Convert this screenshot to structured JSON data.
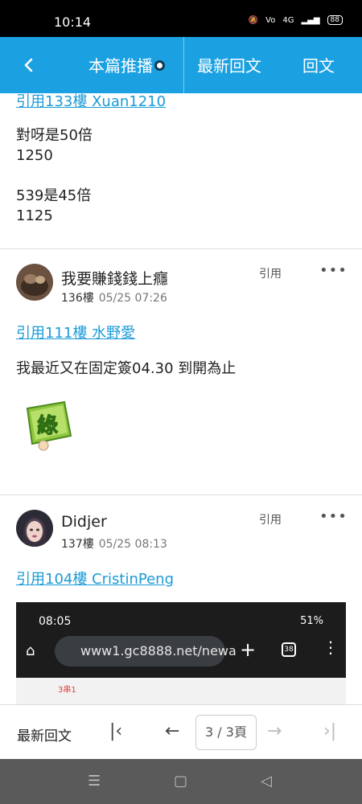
{
  "status_bar": {
    "time": "10:14",
    "network": "4G",
    "battery": "88"
  },
  "header": {
    "tabs": [
      {
        "label": "本篇推播"
      },
      {
        "label": "最新回文"
      },
      {
        "label": "回文"
      }
    ],
    "accent_color": "#1ba1e2"
  },
  "posts": [
    {
      "quote": "引用133樓 Xuan1210",
      "text": "對呀是50倍\n1250\n\n539是45倍\n1125"
    },
    {
      "author": "我要賺錢錢上癮",
      "floor": "136樓",
      "time": "05/25 07:26",
      "quote_action": "引用",
      "more": "•••",
      "quote": "引用111樓 水野愛",
      "text": "我最近又在固定簽04.30 到開為止",
      "sticker_label": "綠"
    },
    {
      "author": "Didjer",
      "floor": "137樓",
      "time": "05/25 08:13",
      "quote_action": "引用",
      "more": "•••",
      "quote": "引用104樓 CristinPeng",
      "screenshot": {
        "status_time": "08:05",
        "status_right": "51%",
        "url": "www1.gc8888.net/newa",
        "tab_count": "38",
        "page_text": "3串1"
      }
    }
  ],
  "bottom_bar": {
    "latest_label": "最新回文",
    "page_indicator": "3 / 3頁"
  }
}
